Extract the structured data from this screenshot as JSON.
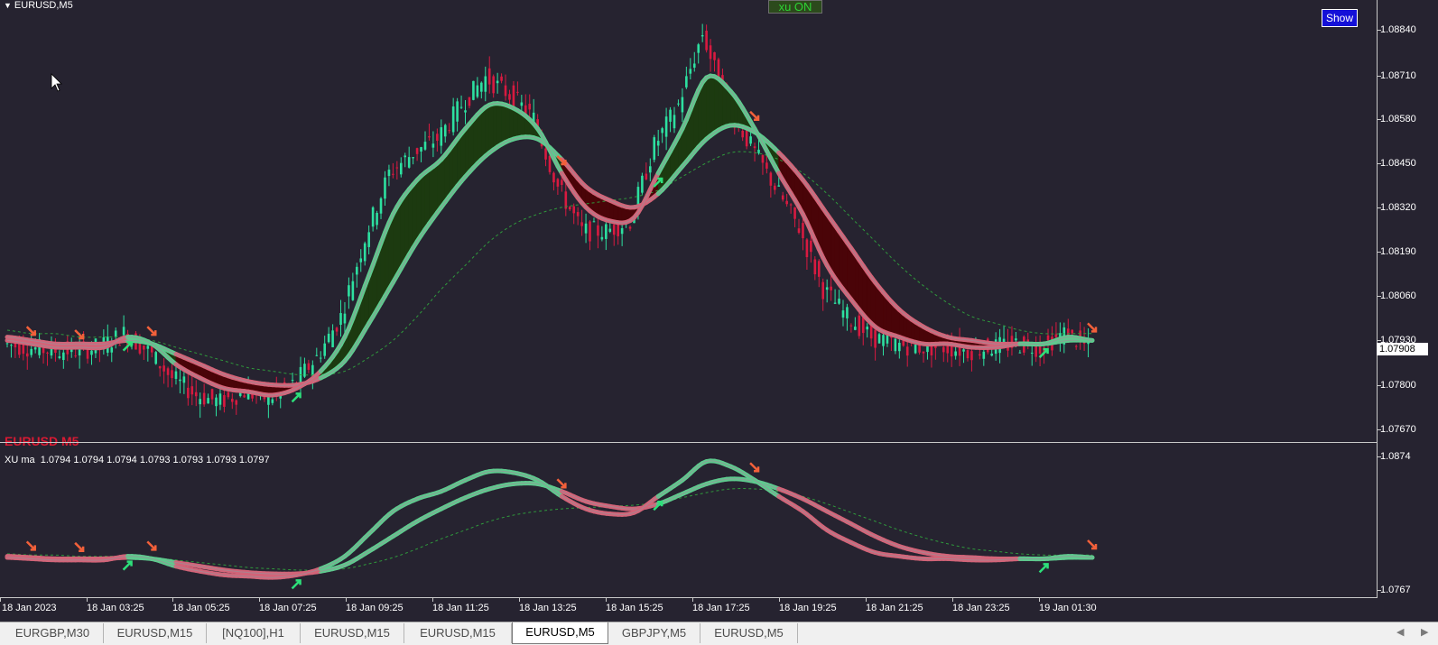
{
  "window": {
    "title": "EURUSD,M5",
    "symbol_watermark": "EURUSD M5"
  },
  "buttons": {
    "xu_toggle": "xu ON",
    "show": "Show"
  },
  "indicator": {
    "label": "XU ma  1.0794 1.0794 1.0794 1.0793 1.0793 1.0793 1.0797"
  },
  "price_axis": {
    "main": [
      "1.08840",
      "1.08710",
      "1.08580",
      "1.08450",
      "1.08320",
      "1.08190",
      "1.08060",
      "1.07930",
      "1.07800",
      "1.07670"
    ],
    "current_price": "1.07908",
    "sub": [
      "1.0874",
      "1.0767"
    ]
  },
  "time_axis": [
    "18 Jan 2023",
    "18 Jan 03:25",
    "18 Jan 05:25",
    "18 Jan 07:25",
    "18 Jan 09:25",
    "18 Jan 11:25",
    "18 Jan 13:25",
    "18 Jan 15:25",
    "18 Jan 17:25",
    "18 Jan 19:25",
    "18 Jan 21:25",
    "18 Jan 23:25",
    "19 Jan 01:30"
  ],
  "tabs": [
    {
      "label": "EURGBP,M30",
      "active": false
    },
    {
      "label": "EURUSD,M15",
      "active": false
    },
    {
      "label": "[NQ100],H1",
      "active": false
    },
    {
      "label": "EURUSD,M15",
      "active": false
    },
    {
      "label": "EURUSD,M15",
      "active": false
    },
    {
      "label": "EURUSD,M5",
      "active": true
    },
    {
      "label": "GBPJPY,M5",
      "active": false
    },
    {
      "label": "EURUSD,M5",
      "active": false
    }
  ],
  "colors": {
    "background": "#262330",
    "bull": "#2de0a0",
    "bear": "#d81a40",
    "fast_ma": "#5fc98e",
    "slow_ma": "#d26478",
    "bull_fill": "#1c3a10",
    "bear_fill": "#4a0408",
    "arrow_up": "#2de07a",
    "arrow_down": "#f2603a"
  },
  "chart_data": {
    "type": "line",
    "title": "EURUSD,M5",
    "ylim": [
      1.0762,
      1.089
    ],
    "price_closes": [
      1.0792,
      1.0791,
      1.079,
      1.079,
      1.0791,
      1.0795,
      1.079,
      1.0782,
      1.0777,
      1.0775,
      1.0778,
      1.0776,
      1.078,
      1.0788,
      1.08,
      1.0823,
      1.0842,
      1.0848,
      1.0852,
      1.0862,
      1.087,
      1.0865,
      1.0858,
      1.0838,
      1.0825,
      1.0825,
      1.0828,
      1.085,
      1.0862,
      1.0883,
      1.0862,
      1.085,
      1.0838,
      1.0826,
      1.0808,
      1.08,
      1.0794,
      1.0792,
      1.0791,
      1.0791,
      1.079,
      1.0791,
      1.0792,
      1.0791,
      1.0795,
      1.0791
    ],
    "ma_fast": [
      1.0793,
      1.0792,
      1.0791,
      1.0791,
      1.0791,
      1.0794,
      1.0792,
      1.0786,
      1.0782,
      1.0779,
      1.0778,
      1.0777,
      1.0779,
      1.0784,
      1.0794,
      1.0812,
      1.083,
      1.084,
      1.0846,
      1.0855,
      1.0862,
      1.0861,
      1.0855,
      1.0842,
      1.0832,
      1.0828,
      1.0829,
      1.0842,
      1.0855,
      1.087,
      1.0866,
      1.0855,
      1.0842,
      1.083,
      1.0815,
      1.0805,
      1.0797,
      1.0794,
      1.0792,
      1.0792,
      1.0791,
      1.0791,
      1.0792,
      1.0792,
      1.0794,
      1.0793
    ],
    "ma_slow": [
      1.0794,
      1.0793,
      1.0792,
      1.0792,
      1.0792,
      1.0793,
      1.0792,
      1.0789,
      1.0786,
      1.0783,
      1.0781,
      1.078,
      1.078,
      1.0782,
      1.0787,
      1.0798,
      1.081,
      1.0822,
      1.0832,
      1.0841,
      1.0848,
      1.0852,
      1.0852,
      1.0846,
      1.0838,
      1.0834,
      1.0832,
      1.0836,
      1.0844,
      1.0852,
      1.0856,
      1.0854,
      1.0848,
      1.084,
      1.083,
      1.082,
      1.081,
      1.0802,
      1.0797,
      1.0794,
      1.0793,
      1.0792,
      1.0792,
      1.0792,
      1.0793,
      1.0793
    ],
    "ma_long": [
      1.0796,
      1.0795,
      1.0795,
      1.0794,
      1.0794,
      1.0794,
      1.0793,
      1.0791,
      1.0789,
      1.0787,
      1.0785,
      1.0784,
      1.0783,
      1.0783,
      1.0784,
      1.0788,
      1.0793,
      1.08,
      1.0808,
      1.0815,
      1.0822,
      1.0827,
      1.083,
      1.0832,
      1.0833,
      1.0834,
      1.0835,
      1.0837,
      1.0841,
      1.0845,
      1.0848,
      1.0848,
      1.0846,
      1.0842,
      1.0836,
      1.0829,
      1.0822,
      1.0815,
      1.0809,
      1.0804,
      1.08,
      1.0798,
      1.0796,
      1.0795,
      1.0795,
      1.0795
    ],
    "signals": [
      {
        "index": 1,
        "dir": "down"
      },
      {
        "index": 3,
        "dir": "down"
      },
      {
        "index": 5,
        "dir": "up"
      },
      {
        "index": 6,
        "dir": "down"
      },
      {
        "index": 12,
        "dir": "up"
      },
      {
        "index": 23,
        "dir": "down"
      },
      {
        "index": 27,
        "dir": "up"
      },
      {
        "index": 31,
        "dir": "down"
      },
      {
        "index": 43,
        "dir": "up"
      },
      {
        "index": 45,
        "dir": "down"
      }
    ]
  }
}
